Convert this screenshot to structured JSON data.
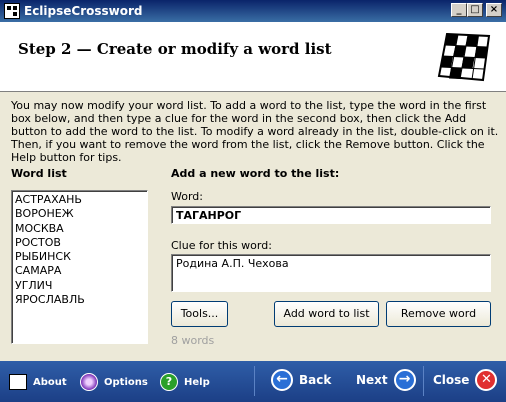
{
  "window": {
    "title": "EclipseCrossword",
    "min_glyph": "_",
    "max_glyph": "□",
    "close_glyph": "×"
  },
  "header": {
    "step_title": "Step 2 — Create or modify a word list"
  },
  "intro": "You may now modify your word list.  To add a word to the list, type the word in the first box below, and then type a clue for the word in the second box, then click the Add button to add the word to the list.  To modify a word already in the list, double-click on it.  Then, if you want to remove the word from the list, click the Remove button.  Click the Help button for tips.",
  "word_list": {
    "label": "Word list",
    "items": [
      "АСТРАХАНЬ",
      "ВОРОНЕЖ",
      "МОСКВА",
      "РОСТОВ",
      "РЫБИНСК",
      "САМАРА",
      "УГЛИЧ",
      "ЯРОСЛАВЛЬ"
    ]
  },
  "add_word": {
    "label": "Add a new word to the list:",
    "word_label": "Word:",
    "word_value": "ТАГАНРОГ",
    "clue_label": "Clue for this word:",
    "clue_value": "Родина А.П. Чехова",
    "tools_button": "Tools...",
    "add_button": "Add word to list",
    "remove_button": "Remove word",
    "count": "8 words"
  },
  "bottom_bar": {
    "about": "About",
    "options": "Options",
    "help": "Help",
    "back": "Back",
    "next": "Next",
    "close": "Close",
    "back_glyph": "←",
    "next_glyph": "→",
    "close_glyph": "✕",
    "help_glyph": "?"
  }
}
